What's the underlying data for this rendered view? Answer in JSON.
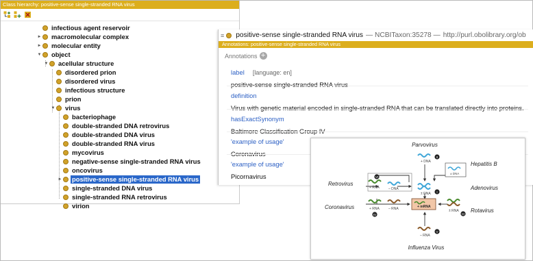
{
  "hierarchy": {
    "title": "Class hierarchy: positive-sense single-stranded RNA virus",
    "items": [
      {
        "label": "infectious agent reservoir"
      },
      {
        "label": "macromolecular complex"
      },
      {
        "label": "molecular entity"
      },
      {
        "label": "object"
      },
      {
        "label": "acellular structure"
      },
      {
        "label": "disordered prion"
      },
      {
        "label": "disordered virus"
      },
      {
        "label": "infectious structure"
      },
      {
        "label": "prion"
      },
      {
        "label": "virus"
      },
      {
        "label": "bacteriophage"
      },
      {
        "label": "double-stranded DNA retrovirus"
      },
      {
        "label": "double-stranded DNA virus"
      },
      {
        "label": "double-stranded RNA virus"
      },
      {
        "label": "mycovirus"
      },
      {
        "label": "negative-sense single-stranded RNA virus"
      },
      {
        "label": "oncovirus"
      },
      {
        "label": "positive-sense single-stranded RNA virus"
      },
      {
        "label": "single-stranded DNA virus"
      },
      {
        "label": "single-stranded RNA retrovirus"
      },
      {
        "label": "virion"
      }
    ]
  },
  "annotations": {
    "entity_name": "positive-sense single-stranded RNA virus",
    "entity_id": "— NCBITaxon:35278 —",
    "entity_iri": "http://purl.obolibrary.org/ob",
    "subtitle": "Annotations: positive-sense single-stranded RNA virus",
    "section_label": "Annotations",
    "add_symbol": "+",
    "entries": [
      {
        "property": "label",
        "lang": "[language: en]",
        "value": "positive-sense single-stranded RNA virus"
      },
      {
        "property": "definition",
        "lang": "",
        "value": "Virus with genetic material encoded in single-stranded RNA that can be translated directly into proteins."
      },
      {
        "property": "hasExactSynonym",
        "lang": "",
        "value": "Baltimore Classification Group IV"
      },
      {
        "property": "'example of usage'",
        "lang": "",
        "value": "Coronavirus"
      },
      {
        "property": "'example of usage'",
        "lang": "",
        "value": "Picornavirus"
      }
    ]
  },
  "diagram": {
    "labels": {
      "parvovirus": "Parvovirus",
      "hepatitis_b": "Hepatitis B",
      "retrovirus": "Retrovirus",
      "adenovirus": "Adenovirus",
      "coronavirus": "Coronavirus",
      "rotavirus": "Rotavirus",
      "influenza": "Influenza Virus"
    },
    "strands": {
      "plus_dna": "+ DNA",
      "minus_dna": "– DNA",
      "pm_dna": "± DNA",
      "plus_rna": "+ RNA",
      "minus_rna": "– RNA",
      "pm_rna": "± RNA",
      "mrna": "+ mRNA"
    },
    "groups": {
      "g1": "I",
      "g2": "II",
      "g3": "III",
      "g4": "IV",
      "g5": "V",
      "g6": "VI",
      "g7": "VII"
    },
    "colors": {
      "blue": "#41a7d8",
      "green": "#4a8b2e",
      "brown": "#8a5a2a",
      "mrna_box": "#f2c7a8",
      "gold": "#dcae1d",
      "selection": "#2a67c9"
    }
  }
}
